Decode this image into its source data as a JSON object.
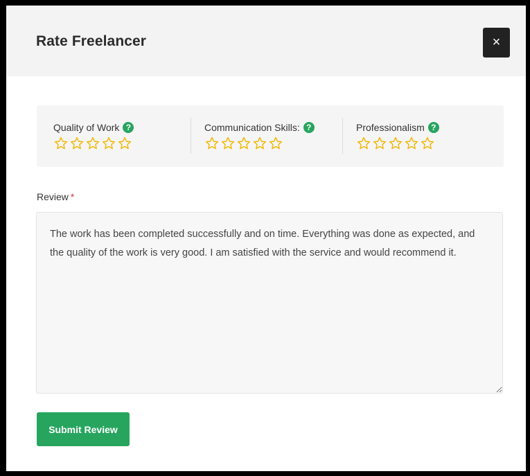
{
  "dialog": {
    "title": "Rate Freelancer",
    "close_label": "×"
  },
  "ratings": [
    {
      "label": "Quality of Work",
      "help": "?",
      "stars_total": 5,
      "stars_filled": 0
    },
    {
      "label": "Communication Skills:",
      "help": "?",
      "stars_total": 5,
      "stars_filled": 0
    },
    {
      "label": "Professionalism",
      "help": "?",
      "stars_total": 5,
      "stars_filled": 0
    }
  ],
  "review": {
    "label": "Review",
    "required_mark": "*",
    "value": "The work has been completed successfully and on time. Everything was done as expected, and the quality of the work is very good. I am satisfied with the service and would recommend it."
  },
  "submit": {
    "label": "Submit Review"
  },
  "colors": {
    "accent_green": "#27a55f",
    "star_outline": "#f2b705",
    "required_red": "#d9343b",
    "close_bg": "#222222"
  },
  "icons": {
    "close": "close-icon",
    "help": "help-icon",
    "star": "star-outline-icon"
  }
}
